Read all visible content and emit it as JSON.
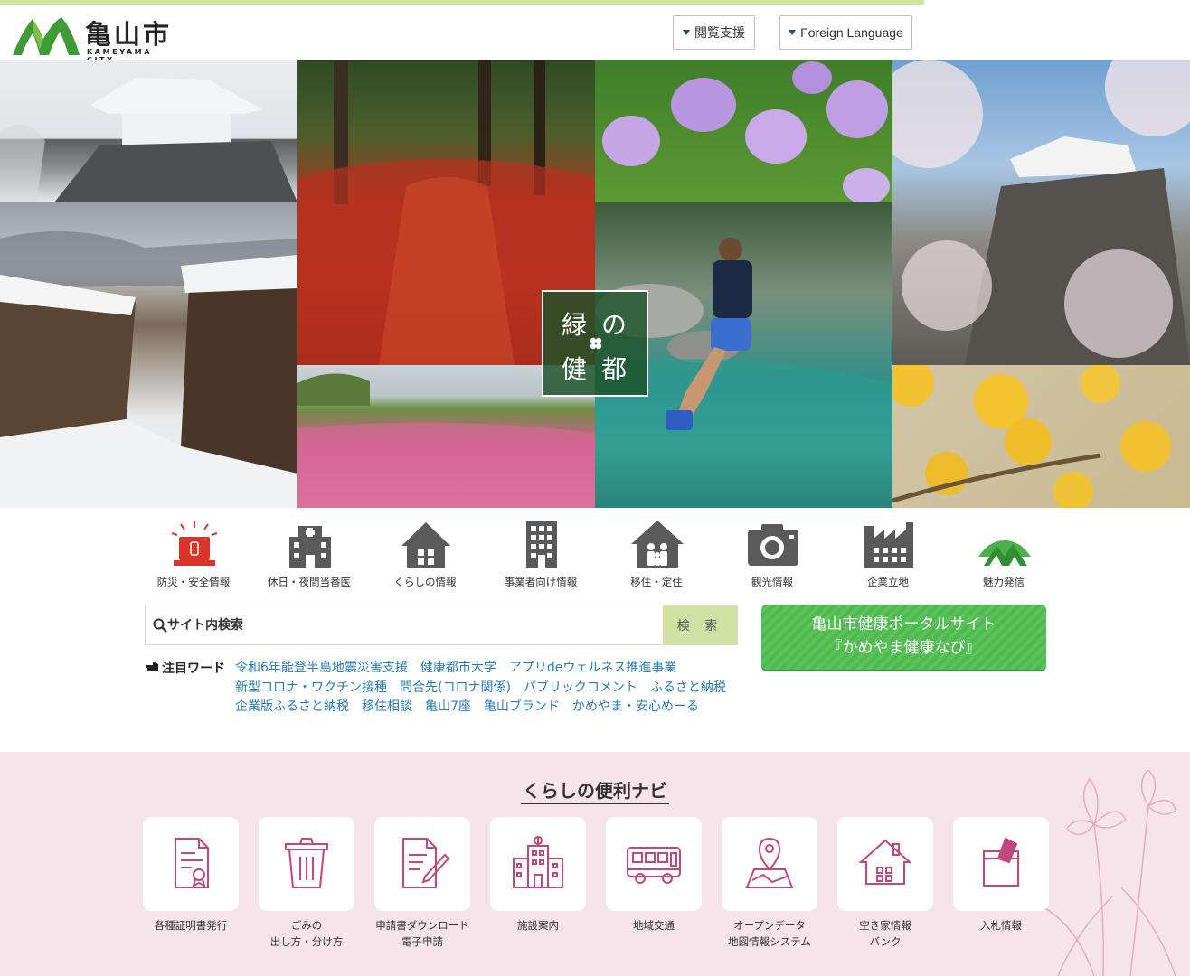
{
  "header": {
    "logo_title": "亀山市",
    "logo_sub": "KAMEYAMA CITY",
    "support_button": "閲覧支援",
    "foreign_button": "Foreign Language"
  },
  "hero": {
    "badge_line1": "緑の",
    "badge_line2": "健都"
  },
  "quick_links": [
    {
      "label": "防災・安全情報",
      "icon": "siren-icon"
    },
    {
      "label": "休日・夜間当番医",
      "icon": "hospital-icon"
    },
    {
      "label": "くらしの情報",
      "icon": "house-icon"
    },
    {
      "label": "事業者向け情報",
      "icon": "office-building-icon"
    },
    {
      "label": "移住・定住",
      "icon": "family-house-icon"
    },
    {
      "label": "観光情報",
      "icon": "camera-icon"
    },
    {
      "label": "企業立地",
      "icon": "factory-icon"
    },
    {
      "label": "魅力発信",
      "icon": "mountain-logo-icon"
    }
  ],
  "search": {
    "placeholder": "サイト内検索",
    "button": "検 索"
  },
  "portal": {
    "line1": "亀山市健康ポータルサイト",
    "line2": "『かめやま健康なび』"
  },
  "hot_words": {
    "label": "注目ワード",
    "items": [
      "令和6年能登半島地震災害支援",
      "健康都市大学",
      "アプリdeウェルネス推進事業",
      "新型コロナ・ワクチン接種",
      "問合先(コロナ関係)",
      "パブリックコメント",
      "ふるさと納税",
      "企業版ふるさと納税",
      "移住相談",
      "亀山7座",
      "亀山ブランド",
      "かめやま・安心めーる"
    ]
  },
  "navi": {
    "title": "くらしの便利ナビ",
    "items": [
      {
        "label1": "各種証明書発行",
        "label2": "",
        "icon": "certificate-icon"
      },
      {
        "label1": "ごみの",
        "label2": "出し方・分け方",
        "icon": "trash-icon"
      },
      {
        "label1": "申請書ダウンロード",
        "label2": "電子申請",
        "icon": "form-pen-icon"
      },
      {
        "label1": "施設案内",
        "label2": "",
        "icon": "building-icon"
      },
      {
        "label1": "地域交通",
        "label2": "",
        "icon": "bus-icon"
      },
      {
        "label1": "オープンデータ",
        "label2": "地図情報システム",
        "icon": "map-pin-icon"
      },
      {
        "label1": "空き家情報",
        "label2": "バンク",
        "icon": "vacant-house-icon"
      },
      {
        "label1": "入札情報",
        "label2": "",
        "icon": "ballot-box-icon"
      }
    ]
  },
  "colors": {
    "accent_green": "#4fb84f",
    "link_blue": "#2a7ab8",
    "navi_bg": "#f7e4ea",
    "navi_icon": "#c2477a",
    "quick_icon": "#5a5a5a",
    "alert_red": "#d9362b"
  }
}
